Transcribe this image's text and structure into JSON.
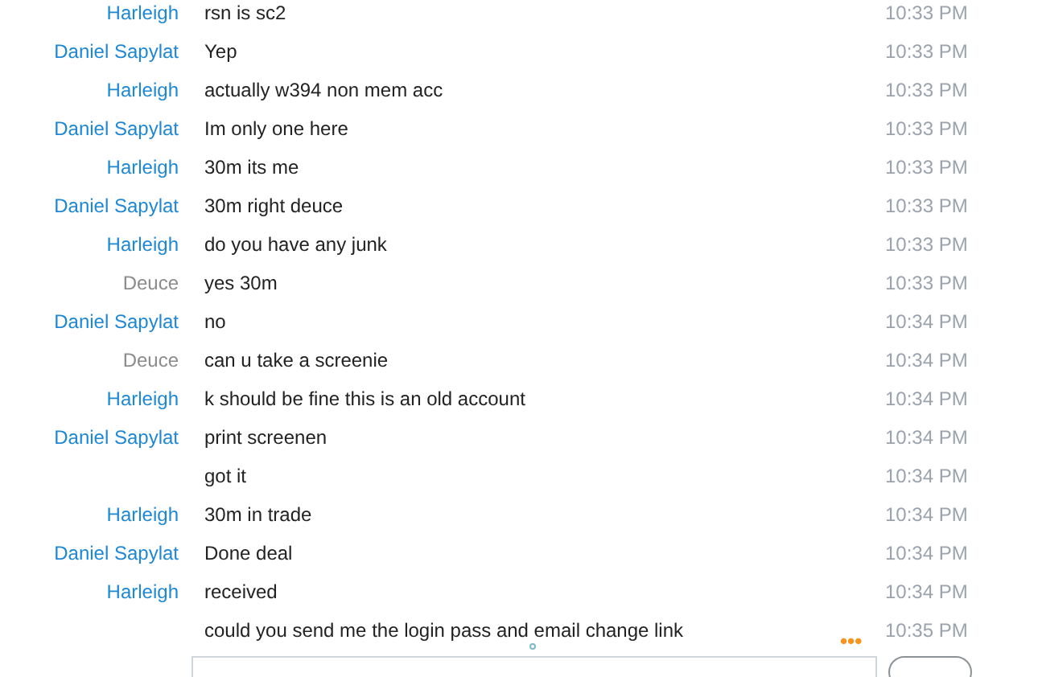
{
  "messages": [
    {
      "sender": "Harleigh",
      "color": "#1e88d4",
      "text": "rsn is sc2",
      "time": "10:33 PM"
    },
    {
      "sender": "Daniel Sapylat",
      "color": "#1e88d4",
      "text": "Yep",
      "time": "10:33 PM"
    },
    {
      "sender": "Harleigh",
      "color": "#1e88d4",
      "text": "actually w394 non mem acc",
      "time": "10:33 PM"
    },
    {
      "sender": "Daniel Sapylat",
      "color": "#1e88d4",
      "text": "Im only one here",
      "time": "10:33 PM"
    },
    {
      "sender": "Harleigh",
      "color": "#1e88d4",
      "text": "30m its me",
      "time": "10:33 PM"
    },
    {
      "sender": "Daniel Sapylat",
      "color": "#1e88d4",
      "text": "30m right deuce",
      "time": "10:33 PM"
    },
    {
      "sender": "Harleigh",
      "color": "#1e88d4",
      "text": "do you have any junk",
      "time": "10:33 PM"
    },
    {
      "sender": "Deuce",
      "color": "#8c8c8c",
      "text": "yes 30m",
      "time": "10:33 PM"
    },
    {
      "sender": "Daniel Sapylat",
      "color": "#1e88d4",
      "text": "no",
      "time": "10:34 PM"
    },
    {
      "sender": "Deuce",
      "color": "#8c8c8c",
      "text": "can u take a screenie",
      "time": "10:34 PM"
    },
    {
      "sender": "Harleigh",
      "color": "#1e88d4",
      "text": "k should be fine this is an old account",
      "time": "10:34 PM"
    },
    {
      "sender": "Daniel Sapylat",
      "color": "#1e88d4",
      "text": "print screenen",
      "time": "10:34 PM"
    },
    {
      "text": "got it",
      "time": "10:34 PM"
    },
    {
      "sender": "Harleigh",
      "color": "#1e88d4",
      "text": "30m in trade",
      "time": "10:34 PM"
    },
    {
      "sender": "Daniel Sapylat",
      "color": "#1e88d4",
      "text": "Done deal",
      "time": "10:34 PM"
    },
    {
      "sender": "Harleigh",
      "color": "#1e88d4",
      "text": "received",
      "time": "10:34 PM"
    },
    {
      "text": "could you send me the login pass and email change link",
      "time": "10:35 PM"
    }
  ],
  "typing_indicator": "•••"
}
